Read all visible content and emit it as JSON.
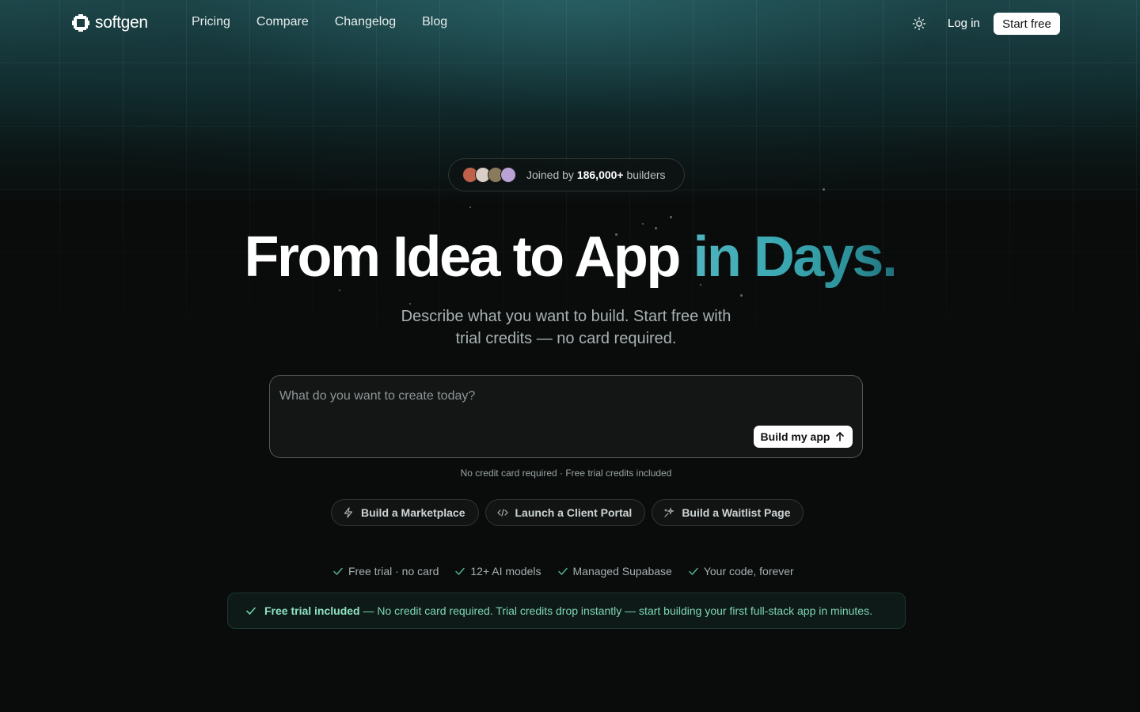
{
  "nav": {
    "logo_text": "softgen",
    "links": [
      "Pricing",
      "Compare",
      "Changelog",
      "Blog"
    ],
    "login_label": "Log in",
    "start_label": "Start free"
  },
  "badge": {
    "prefix": "Joined by",
    "count": "186,000+",
    "suffix": "builders",
    "avatar_colors": [
      "#c0624a",
      "#d9cfc4",
      "#8a7a5c",
      "#b9a2d6"
    ]
  },
  "hero": {
    "headline_main": "From Idea to App",
    "headline_accent": "in Days.",
    "subhead": "Describe what you want to build. Start free with trial credits — no card required."
  },
  "prompt": {
    "placeholder": "What do you want to create today?",
    "value": "",
    "button_label": "Build my app"
  },
  "note": "No credit card required · Free trial credits included",
  "chips": [
    {
      "label": "Build a Marketplace",
      "icon": "lightning-icon"
    },
    {
      "label": "Launch a Client Portal",
      "icon": "code-icon"
    },
    {
      "label": "Build a Waitlist Page",
      "icon": "sparkle-icon"
    }
  ],
  "features": [
    "Free trial · no card",
    "12+ AI models",
    "Managed Supabase",
    "Your code, forever"
  ],
  "trial_bar": {
    "strong": "Free trial included",
    "text": " — No credit card required. Trial credits drop instantly — start building your first full-stack app in minutes."
  },
  "colors": {
    "accent": "#3aa8b1",
    "check_green": "#4fb08a",
    "trial_text": "#7ed6b4"
  }
}
